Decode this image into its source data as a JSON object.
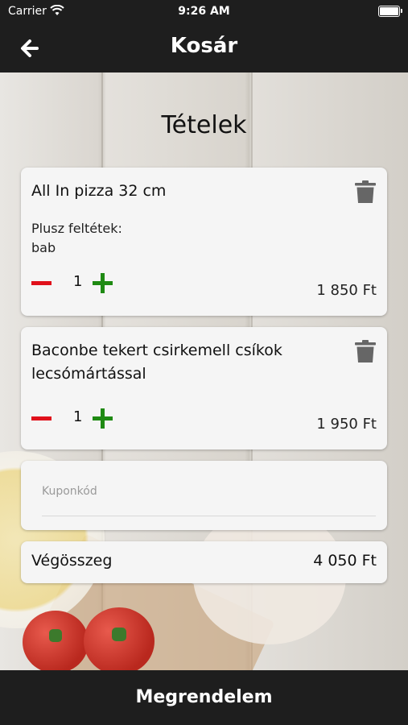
{
  "status_bar": {
    "carrier": "Carrier",
    "time": "9:26 AM"
  },
  "navbar": {
    "title": "Kosár"
  },
  "section_title": "Tételek",
  "items": [
    {
      "name": "All In pizza 32 cm",
      "extras_label": "Plusz feltétek:",
      "extras": "bab",
      "quantity": "1",
      "price": "1 850 Ft"
    },
    {
      "name": "Baconbe tekert csirkemell csíkok lecsómártással",
      "quantity": "1",
      "price": "1 950 Ft"
    }
  ],
  "coupon": {
    "placeholder": "Kuponkód",
    "value": ""
  },
  "total": {
    "label": "Végösszeg",
    "value": "4 050 Ft"
  },
  "order_button": {
    "label": "Megrendelem"
  },
  "colors": {
    "bar_background": "#1e1e1e",
    "minus": "#e0111b",
    "plus": "#1f8a13",
    "card": "#f5f5f5"
  }
}
